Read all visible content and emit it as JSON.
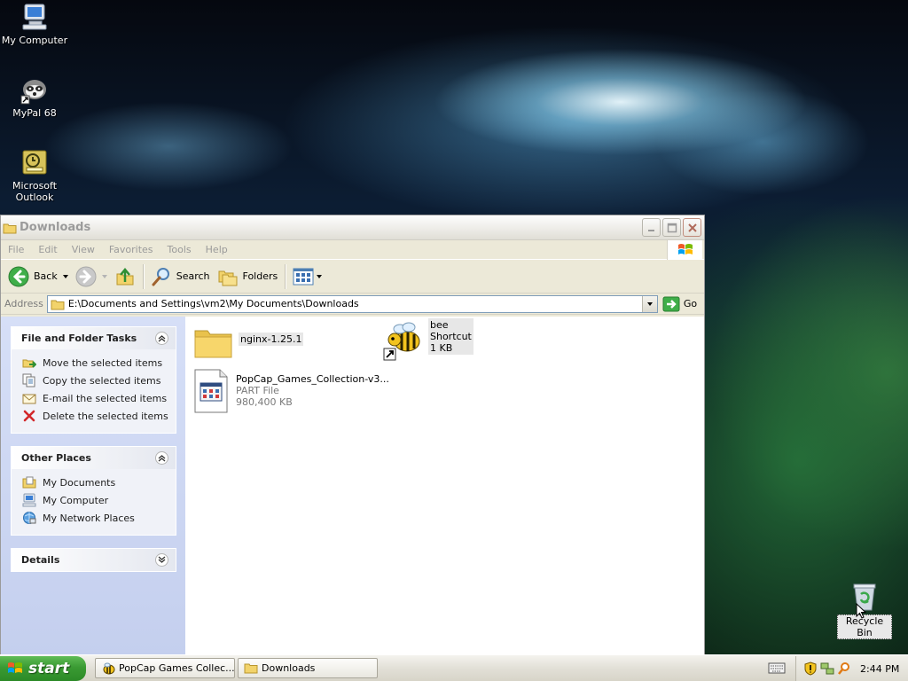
{
  "desktop": {
    "icons": [
      {
        "label": "My Computer",
        "icon": "my-computer-icon"
      },
      {
        "label": "MyPal 68",
        "icon": "raccoon-browser-icon"
      },
      {
        "label": "Microsoft\nOutlook",
        "label_line1": "Microsoft",
        "label_line2": "Outlook",
        "icon": "outlook-icon"
      }
    ],
    "recycle_bin": {
      "label": "Recycle Bin",
      "icon": "recycle-bin-icon"
    }
  },
  "window": {
    "title": "Downloads",
    "menu": [
      "File",
      "Edit",
      "View",
      "Favorites",
      "Tools",
      "Help"
    ],
    "toolbar": {
      "back_label": "Back",
      "search_label": "Search",
      "folders_label": "Folders"
    },
    "address": {
      "label": "Address",
      "value": "E:\\Documents and Settings\\vm2\\My Documents\\Downloads",
      "go_label": "Go"
    },
    "taskpane": {
      "file_folder_tasks": {
        "title": "File and Folder Tasks",
        "items": [
          {
            "label": "Move the selected items",
            "icon": "move-icon"
          },
          {
            "label": "Copy the selected items",
            "icon": "copy-icon"
          },
          {
            "label": "E-mail the selected items",
            "icon": "email-icon"
          },
          {
            "label": "Delete the selected items",
            "icon": "delete-icon"
          }
        ]
      },
      "other_places": {
        "title": "Other Places",
        "items": [
          {
            "label": "My Documents",
            "icon": "my-documents-icon"
          },
          {
            "label": "My Computer",
            "icon": "my-computer-icon"
          },
          {
            "label": "My Network Places",
            "icon": "network-places-icon"
          }
        ]
      },
      "details": {
        "title": "Details"
      }
    },
    "files": [
      {
        "name": "nginx-1.25.1",
        "type": "",
        "size": "",
        "icon": "folder-icon"
      },
      {
        "name": "bee",
        "type": "Shortcut",
        "size": "1 KB",
        "icon": "bee-shortcut-icon"
      },
      {
        "name": "PopCap_Games_Collection-v3...",
        "type": "PART File",
        "size": "980,400 KB",
        "icon": "part-file-icon"
      }
    ]
  },
  "taskbar": {
    "start_label": "start",
    "buttons": [
      {
        "label": "PopCap Games Collec...",
        "icon": "bee-icon"
      },
      {
        "label": "Downloads",
        "icon": "folder-icon"
      }
    ],
    "clock": "2:44 PM"
  },
  "colors": {
    "taskpane_bg": "#d6dff7",
    "start_green": "#3a9a33",
    "title_text_inactive": "#9b9b9b"
  }
}
